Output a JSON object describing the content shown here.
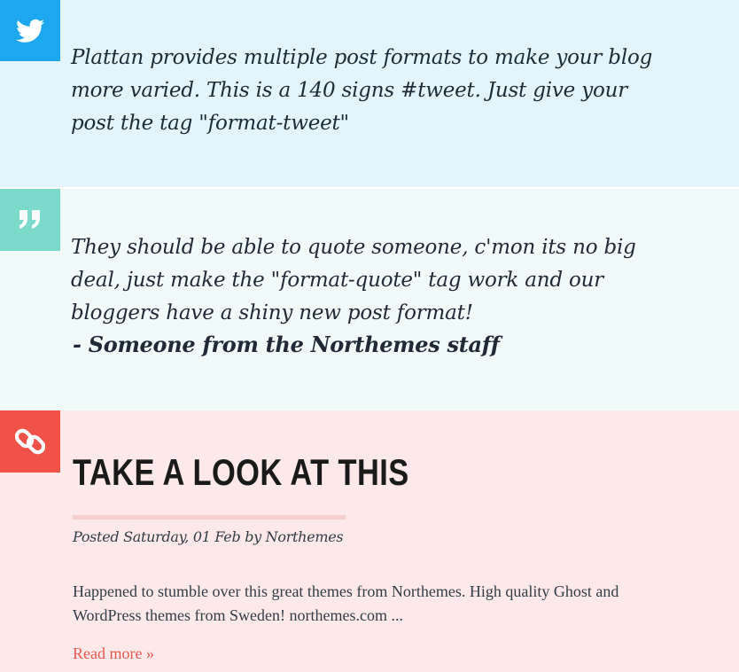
{
  "posts": {
    "tweet": {
      "icon": "twitter-icon",
      "icon_bg": "#1da7ee",
      "section_bg": "#e3f4fd",
      "text": "Plattan provides multiple post formats to make your blog more varied. This is a 140 signs #tweet. Just give your post the tag \"format-tweet\""
    },
    "quote": {
      "icon": "quote-icon",
      "icon_bg": "#7bdac9",
      "section_bg": "#effaf9",
      "text": "They should be able to quote someone, c'mon its no big deal, just make the \"format-quote\" tag work and our bloggers have a shiny new post format!",
      "author": "- Someone from the Northemes staff"
    },
    "link": {
      "icon": "link-icon",
      "icon_bg": "#f15248",
      "section_bg": "#fde9e9",
      "title": "TAKE A LOOK AT THIS",
      "meta": "Posted Saturday, 01 Feb by Northemes",
      "excerpt": "Happened to stumble over this great themes from Northemes. High quality Ghost and WordPress themes from Sweden! northemes.com ...",
      "read_more": "Read more »",
      "accent": "#e8584e"
    }
  }
}
